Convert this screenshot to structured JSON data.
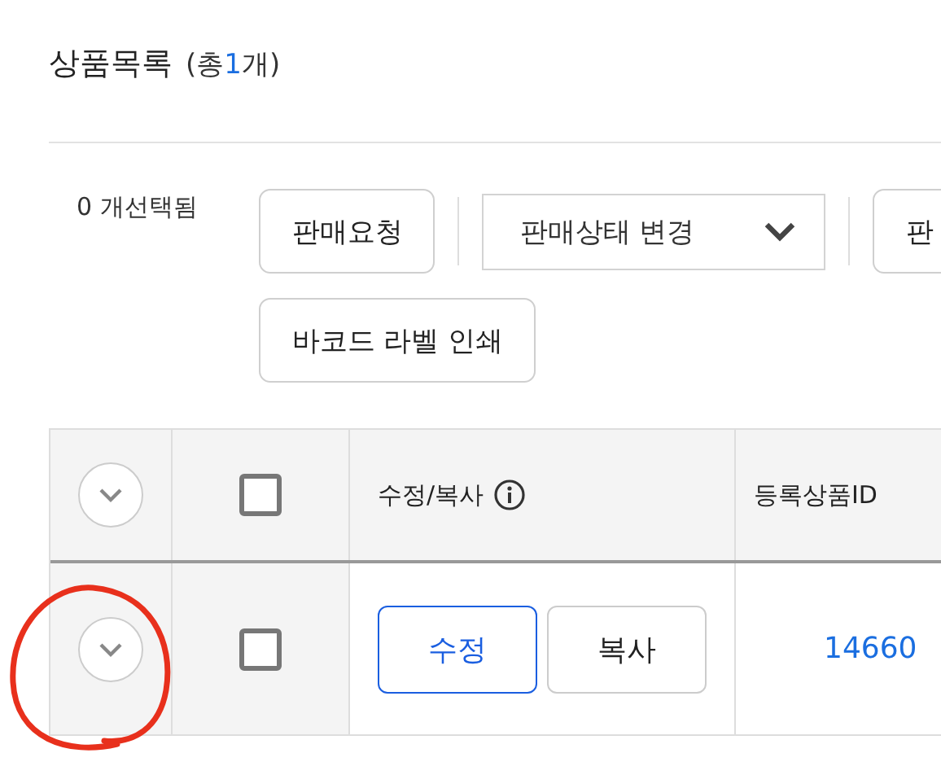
{
  "title": {
    "text": "상품목록",
    "count_prefix": "(총",
    "count": "1",
    "count_suffix": "개)"
  },
  "selection": "0 개선택됨",
  "action_rows": [
    [
      {
        "kind": "button",
        "label": "판매요청"
      },
      {
        "kind": "dropdown",
        "label": "판매상태 변경"
      },
      {
        "kind": "button",
        "label": "판"
      }
    ],
    [
      {
        "kind": "button",
        "label": "바코드 라벨 인쇄"
      }
    ]
  ],
  "table": {
    "columns": [
      {
        "kind": "expand",
        "expanded": false
      },
      {
        "kind": "checkbox",
        "checked": false
      },
      {
        "kind": "text",
        "label": "수정/복사",
        "info": true
      },
      {
        "kind": "text",
        "label": "등록상품ID"
      }
    ],
    "rows": [
      {
        "expanded": false,
        "checked": false,
        "edit": "수정",
        "copy": "복사",
        "id": "14660"
      }
    ]
  },
  "annotations": [
    {
      "kind": "circle"
    }
  ]
}
